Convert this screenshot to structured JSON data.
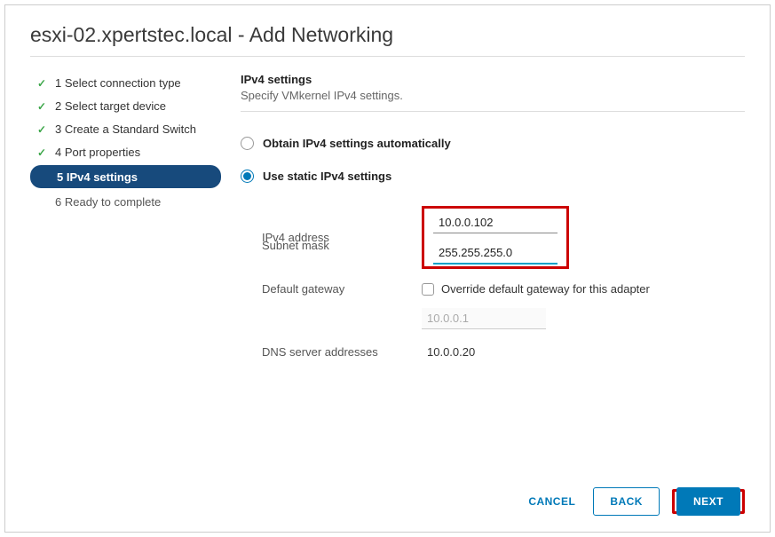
{
  "title": "esxi-02.xpertstec.local - Add Networking",
  "steps": [
    {
      "label": "1 Select connection type",
      "state": "done"
    },
    {
      "label": "2 Select target device",
      "state": "done"
    },
    {
      "label": "3 Create a Standard Switch",
      "state": "done"
    },
    {
      "label": "4 Port properties",
      "state": "done"
    },
    {
      "label": "5 IPv4 settings",
      "state": "active"
    },
    {
      "label": "6 Ready to complete",
      "state": "pending"
    }
  ],
  "panel": {
    "heading": "IPv4 settings",
    "subheading": "Specify VMkernel IPv4 settings."
  },
  "radios": {
    "auto": "Obtain IPv4 settings automatically",
    "static": "Use static IPv4 settings",
    "selected": "static"
  },
  "form": {
    "ipv4_label": "IPv4 address",
    "ipv4_value": "10.0.0.102",
    "subnet_label": "Subnet mask",
    "subnet_value": "255.255.255.0",
    "gateway_label": "Default gateway",
    "gateway_override": "Override default gateway for this adapter",
    "gateway_value": "10.0.0.1",
    "dns_label": "DNS server addresses",
    "dns_value": "10.0.0.20"
  },
  "footer": {
    "cancel": "CANCEL",
    "back": "BACK",
    "next": "NEXT"
  }
}
